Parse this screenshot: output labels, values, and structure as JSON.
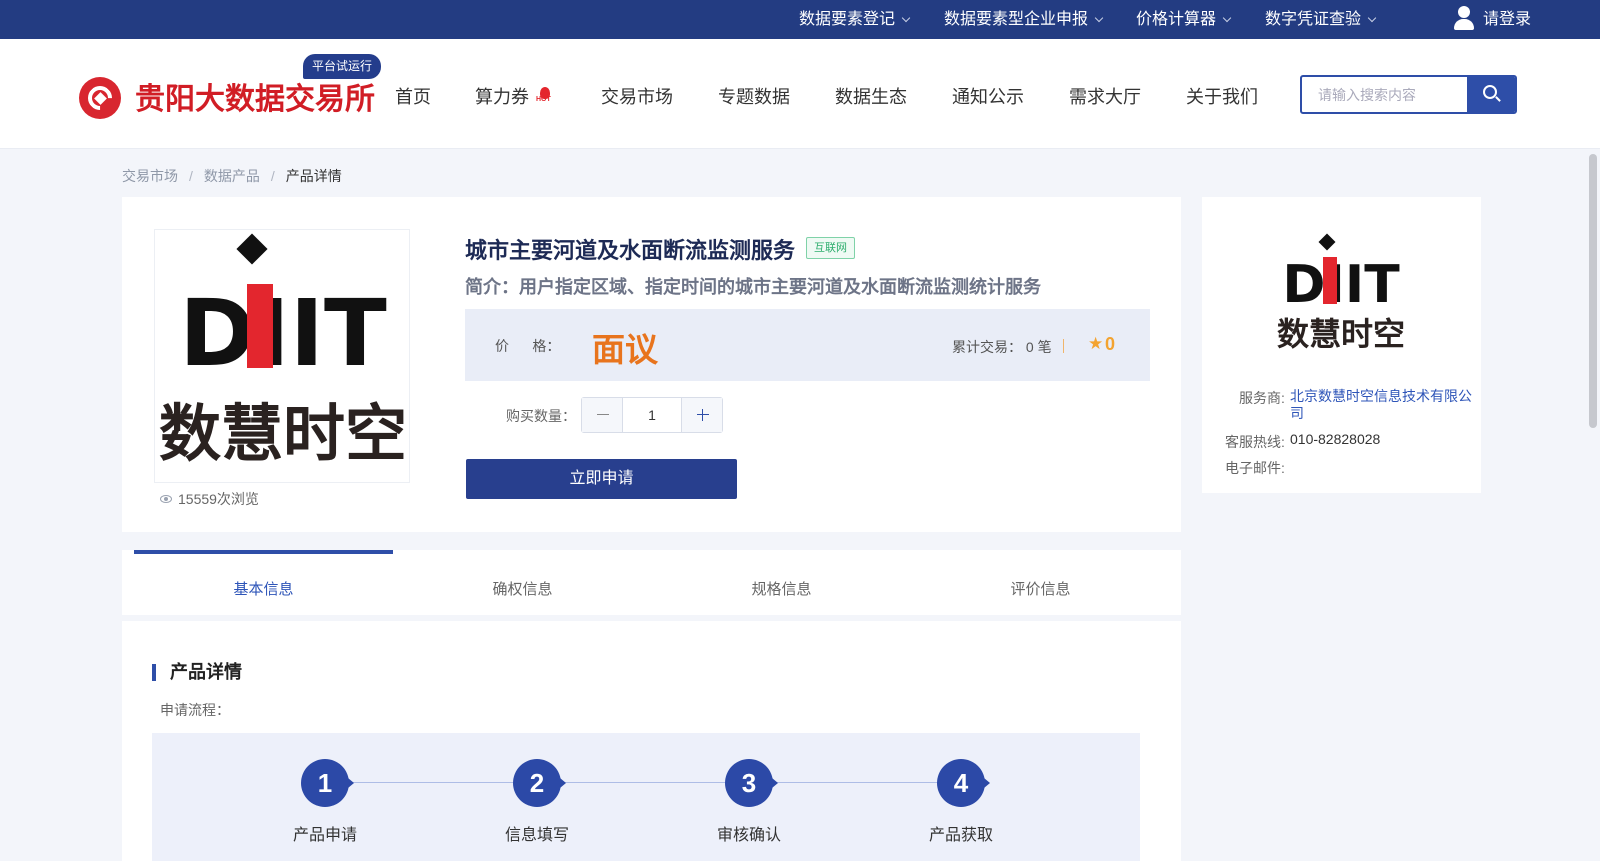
{
  "topbar": {
    "items": [
      "数据要素登记",
      "数据要素型企业申报",
      "价格计算器",
      "数字凭证查验"
    ],
    "login": "请登录"
  },
  "header": {
    "site_name": "贵阳大数据交易所",
    "beta_badge": "平台试运行",
    "nav": [
      "首页",
      "算力券",
      "交易市场",
      "专题数据",
      "数据生态",
      "通知公示",
      "需求大厅",
      "关于我们"
    ],
    "hot_icon_text": "HOT",
    "search": {
      "placeholder": "请输入搜索内容"
    }
  },
  "breadcrumb": [
    "交易市场",
    "数据产品",
    "产品详情"
  ],
  "product": {
    "logo_letters": "DIIT",
    "logo_cn": "数慧时空",
    "views": "15559次浏览",
    "title": "城市主要河道及水面断流监测服务",
    "tag": "互联网",
    "intro": "简介：用户指定区域、指定时间的城市主要河道及水面断流监测统计服务",
    "price_label": "价      格：",
    "price_value": "面议",
    "deals": "累计交易：  0 笔",
    "rating": "0",
    "qty_label": "购买数量：",
    "qty_value": "1",
    "apply_button": "立即申请"
  },
  "provider_card": {
    "provider_label": "服务商:",
    "provider_value": "北京数慧时空信息技术有限公司",
    "hotline_label": "客服热线:",
    "hotline_value": "010-82828028",
    "email_label": "电子邮件:"
  },
  "tabs": [
    "基本信息",
    "确权信息",
    "规格信息",
    "评价信息"
  ],
  "detail": {
    "section_title": "产品详情",
    "flow_label": "申请流程：",
    "steps": [
      {
        "num": "1",
        "label": "产品申请"
      },
      {
        "num": "2",
        "label": "信息填写"
      },
      {
        "num": "3",
        "label": "审核确认"
      },
      {
        "num": "4",
        "label": "产品获取"
      }
    ]
  },
  "colors": {
    "topbar": "#233c82",
    "brand_red": "#d11d25",
    "primary": "#2e4ea8",
    "price_orange": "#e8741d"
  }
}
